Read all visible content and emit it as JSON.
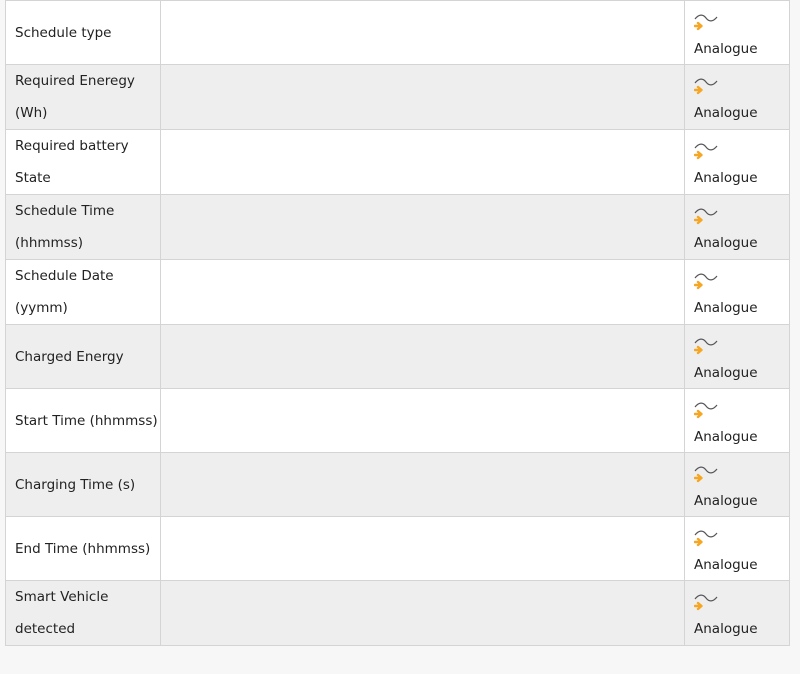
{
  "accent_color": "#f5a623",
  "rows": [
    {
      "label": "Schedule type",
      "value": "",
      "type_icon": "analogue-signal-icon",
      "type": "Analogue"
    },
    {
      "label": "Required Eneregy (Wh)",
      "value": "",
      "type_icon": "analogue-signal-icon",
      "type": "Analogue"
    },
    {
      "label": "Required battery State",
      "value": "",
      "type_icon": "analogue-signal-icon",
      "type": "Analogue"
    },
    {
      "label": "Schedule Time (hhmmss)",
      "value": "",
      "type_icon": "analogue-signal-icon",
      "type": "Analogue"
    },
    {
      "label": "Schedule Date (yymm)",
      "value": "",
      "type_icon": "analogue-signal-icon",
      "type": "Analogue"
    },
    {
      "label": "Charged Energy",
      "value": "",
      "type_icon": "analogue-signal-icon",
      "type": "Analogue"
    },
    {
      "label": "Start Time (hhmmss)",
      "value": "",
      "type_icon": "analogue-signal-icon",
      "type": "Analogue"
    },
    {
      "label": "Charging Time (s)",
      "value": "",
      "type_icon": "analogue-signal-icon",
      "type": "Analogue"
    },
    {
      "label": "End Time (hhmmss)",
      "value": "",
      "type_icon": "analogue-signal-icon",
      "type": "Analogue"
    },
    {
      "label": "Smart Vehicle detected",
      "value": "",
      "type_icon": "analogue-signal-icon",
      "type": "Analogue"
    }
  ]
}
